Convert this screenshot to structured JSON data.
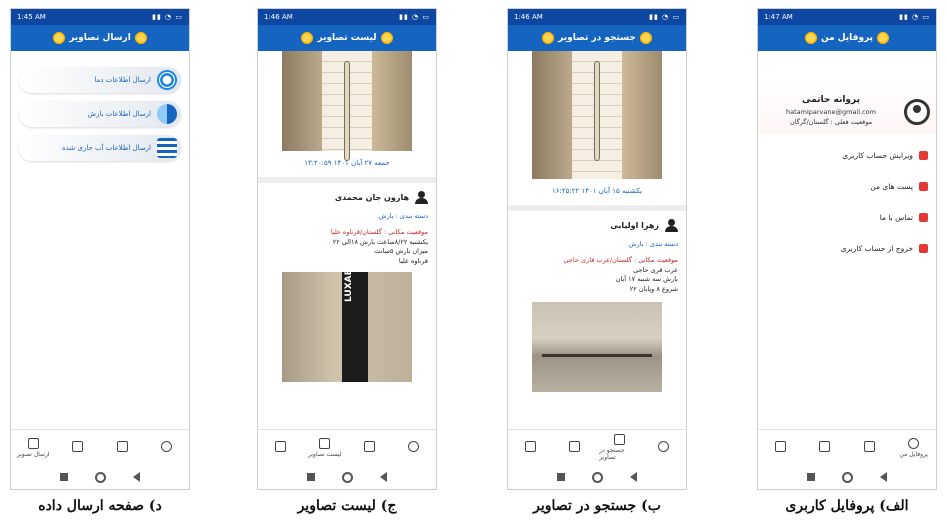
{
  "screens": {
    "profile": {
      "time": "1:47 AM",
      "title": "پروفایل من",
      "name": "پروانه حاتمی",
      "email": "hatamiparvane@gmail.com",
      "location": "موقعیت فعلی : گلستان/گرگان",
      "menu": [
        "ویرایش حساب کاربری",
        "پست های من",
        "تماس با ما",
        "خروج از حساب کاربری"
      ],
      "nav_active_label": "پروفایل من",
      "caption": "الف) پروفایل کاربری"
    },
    "search": {
      "time": "1:46 AM",
      "title": "جستجو در تصاویر",
      "date": "یکشنبه ۱۵ آبان ۱۴۰۱ ۱۶:۲۵:۲۲",
      "user": "زهرا اولیایی",
      "category": "دسته بندی : بارش",
      "location": "موقعیت مکانی : گلستان/عرب قاری حاجی",
      "desc": [
        "عرب قری حاجی",
        "بارش سه شنبه ۱۷ آبان",
        "شروع ۸ وپایان ۲۲"
      ],
      "nav_active_label": "جستجو در تصاویر",
      "caption": "ب) جستجو در تصاویر"
    },
    "list": {
      "time": "1:46 AM",
      "title": "لیست تصاویر",
      "date": "جمعه ۲۷ آبان ۱۴۰۱ ۱۳:۲۰:۵۹",
      "user": "هارون جان محمدی",
      "category": "دسته بندی : بارش",
      "location": "موقعیت مکانی : گلستان/قرناوه علیا",
      "desc": [
        "یکشنبه ۸/۲۲ساعت بارش ۱۸الی ۲۲",
        "میزان بارش ۵سانت",
        "قرناوه علیا"
      ],
      "photo_text": "LUXAB",
      "nav_active_label": "لیست تصاویر",
      "caption": "ج) لیست تصاویر"
    },
    "send": {
      "time": "1:45 AM",
      "title": "ارسال تصاویر",
      "buttons": [
        "ارسال اطلاعات دما",
        "ارسال اطلاعات بارش",
        "ارسال اطلاعات آب جاری شده"
      ],
      "nav_active_label": "ارسال تصویر",
      "caption": "د) صفحه ارسال داده"
    }
  },
  "colors": {
    "statusbar": "#0d47a1",
    "appbar": "#1565c0",
    "accent": "#1565c0",
    "danger": "#c62828",
    "menu_icon": "#e53935"
  },
  "icons": {
    "title": "sun-icon",
    "profile": "avatar-icon",
    "user": "user-icon",
    "nav": [
      "send-icon",
      "list-icon",
      "search-image-icon",
      "profile-icon"
    ]
  }
}
